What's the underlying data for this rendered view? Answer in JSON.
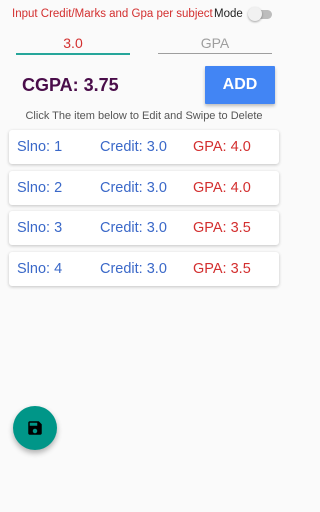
{
  "header": {
    "instruction": "Input Credit/Marks and Gpa per subject",
    "mode_label": "Mode"
  },
  "inputs": {
    "credit_value": "3.0",
    "gpa_placeholder": "GPA"
  },
  "summary": {
    "cgpa_text": "CGPA: 3.75",
    "add_label": "ADD"
  },
  "hint": "Click The item below to Edit and Swipe to Delete",
  "subjects": [
    {
      "slno": "Slno: 1",
      "credit": "Credit: 3.0",
      "gpa": "GPA: 4.0"
    },
    {
      "slno": "Slno: 2",
      "credit": "Credit: 3.0",
      "gpa": "GPA: 4.0"
    },
    {
      "slno": "Slno: 3",
      "credit": "Credit: 3.0",
      "gpa": "GPA: 3.5"
    },
    {
      "slno": "Slno: 4",
      "credit": "Credit: 3.0",
      "gpa": "GPA: 3.5"
    }
  ],
  "icons": {
    "fab": "save-icon"
  },
  "colors": {
    "accent_red": "#d32f2f",
    "accent_teal": "#009688",
    "button_blue": "#4285f4",
    "cgpa_purple": "#4a0d4a",
    "row_blue": "#3a68c8"
  }
}
